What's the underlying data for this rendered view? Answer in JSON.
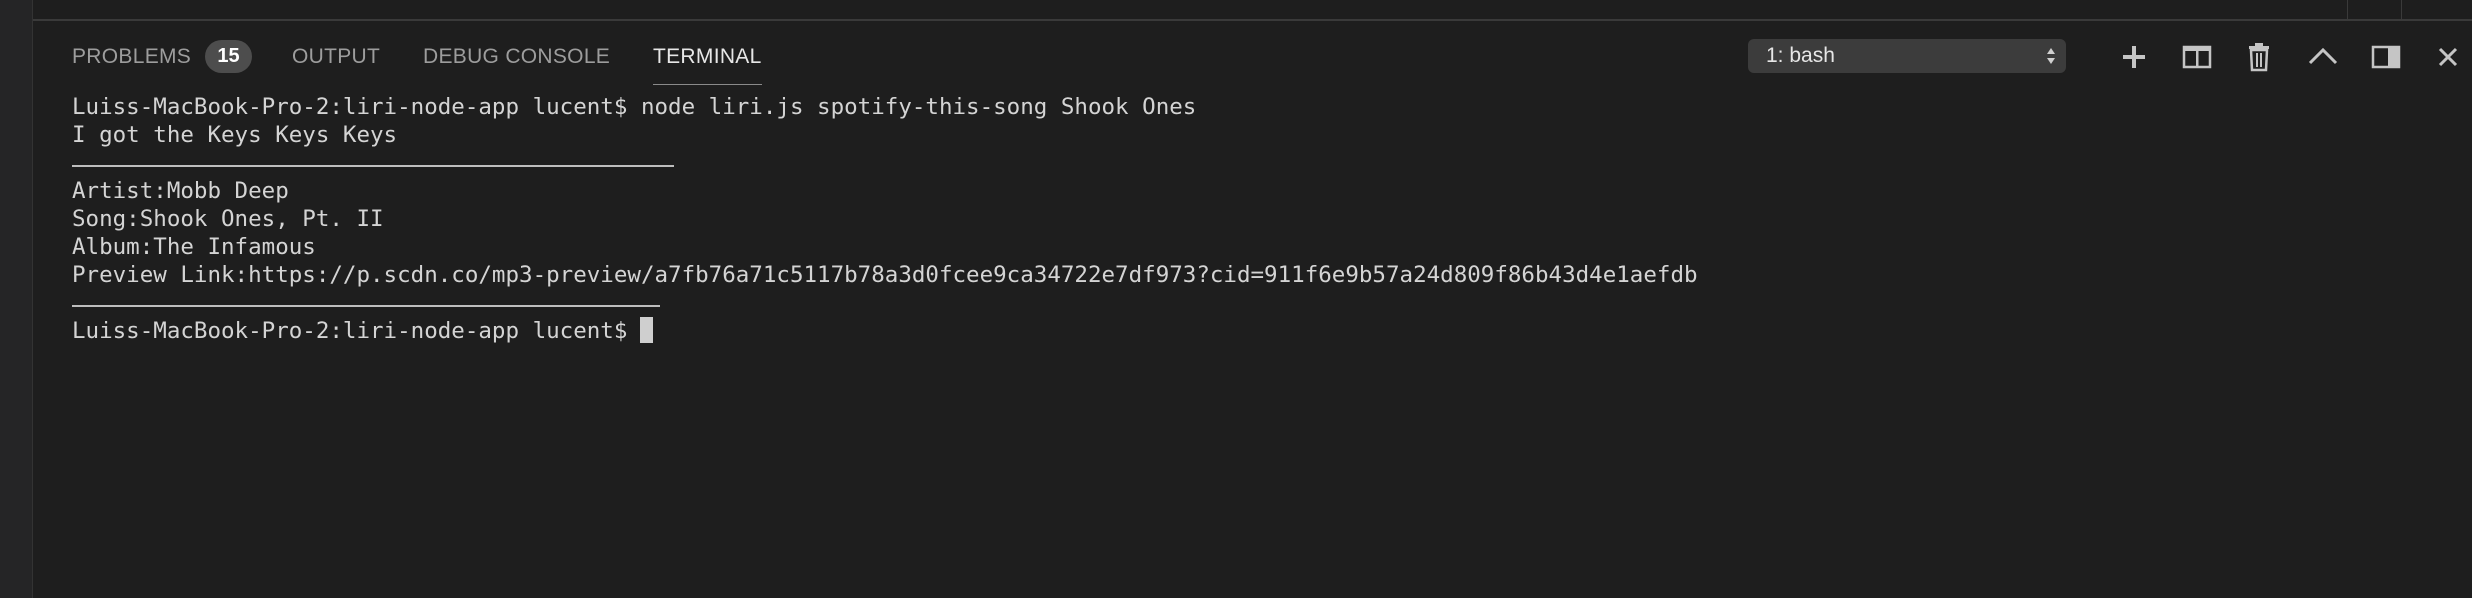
{
  "panel": {
    "tabs": [
      {
        "label": "PROBLEMS",
        "active": false
      },
      {
        "label": "OUTPUT",
        "active": false
      },
      {
        "label": "DEBUG CONSOLE",
        "active": false
      },
      {
        "label": "TERMINAL",
        "active": true
      }
    ],
    "problems_count": "15",
    "terminal_select": {
      "value": "1: bash"
    },
    "actions": [
      "plus-icon",
      "split-terminal-icon",
      "trash-icon",
      "chevron-up-icon",
      "toggle-panel-icon",
      "close-icon"
    ]
  },
  "terminal": {
    "lines": [
      "Luiss-MacBook-Pro-2:liri-node-app lucent$ node liri.js spotify-this-song Shook Ones",
      "I got the Keys Keys Keys",
      "",
      "Artist:Mobb Deep",
      "Song:Shook Ones, Pt. II",
      "Album:The Infamous",
      "Preview Link:https://p.scdn.co/mp3-preview/a7fb76a71c5117b78a3d0fcee9ca34722e7df973?cid=911f6e9b57a24d809f86b43d4e1aefdb",
      "",
      "Luiss-MacBook-Pro-2:liri-node-app lucent$"
    ]
  },
  "colors": {
    "background": "#1e1e1e",
    "tab_inactive": "#9d9d9d",
    "tab_active": "#e7e7e7",
    "badge": "#4d4d4d",
    "text": "#d4d4d4"
  }
}
